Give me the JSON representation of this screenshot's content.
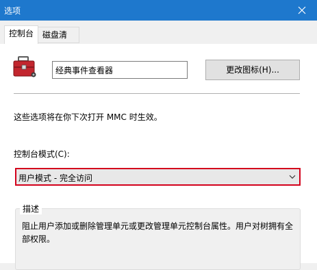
{
  "window": {
    "title": "选项"
  },
  "tabs": [
    {
      "label": "控制台"
    },
    {
      "label": "磁盘清理"
    }
  ],
  "console": {
    "name_value": "经典事件查看器",
    "change_icon_label": "更改图标(H)...",
    "info_text": "这些选项将在你下次打开 MMC 时生效。",
    "mode_label": "控制台模式(C):",
    "mode_selected": "用户模式 - 完全访问",
    "description_legend": "描述",
    "description_text": "阻止用户添加或删除管理单元或更改管理单元控制台属性。用户对树拥有全部权限。"
  },
  "colors": {
    "titlebar": "#1e78cd",
    "highlight_border": "#d3001b"
  },
  "icons": [
    "close-icon",
    "toolbox-icon",
    "chevron-down-icon"
  ]
}
